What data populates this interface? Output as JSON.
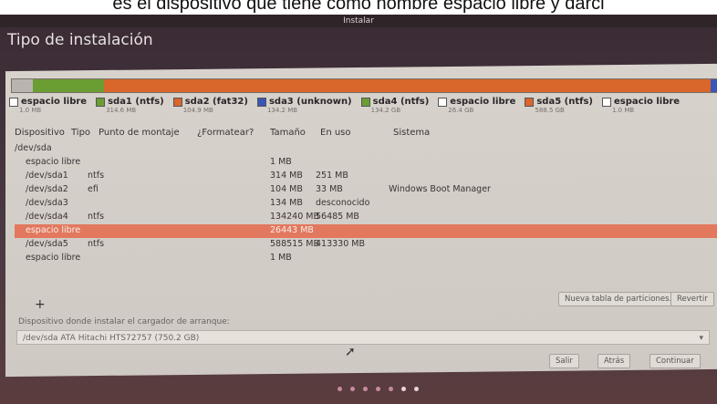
{
  "caption": "es el dispositivo que tiene como nombre espacio libre y darcl",
  "window": {
    "title": "Instalar"
  },
  "page_title": "Tipo de instalación",
  "partition_bar": [
    {
      "color": "#b9b4b0",
      "share": 3
    },
    {
      "color": "#6a9e32",
      "share": 10
    },
    {
      "color": "#d9662b",
      "share": 86
    },
    {
      "color": "#3a56b8",
      "share": 1
    }
  ],
  "legend": [
    {
      "label": "espacio libre",
      "size": "1.0 MB",
      "color": "#ffffff"
    },
    {
      "label": "sda1 (ntfs)",
      "size": "314.6 MB",
      "color": "#6a9e32"
    },
    {
      "label": "sda2 (fat32)",
      "size": "104.9 MB",
      "color": "#d9662b"
    },
    {
      "label": "sda3 (unknown)",
      "size": "134.2 MB",
      "color": "#3a56b8"
    },
    {
      "label": "sda4 (ntfs)",
      "size": "134.2 GB",
      "color": "#6a9e32"
    },
    {
      "label": "espacio libre",
      "size": "26.4 GB",
      "color": "#ffffff"
    },
    {
      "label": "sda5 (ntfs)",
      "size": "588.5 GB",
      "color": "#d9662b"
    },
    {
      "label": "espacio libre",
      "size": "1.0 MB",
      "color": "#ffffff"
    }
  ],
  "table": {
    "headers": [
      "Dispositivo",
      "Tipo",
      "Punto de montaje",
      "¿Formatear?",
      "Tamaño",
      "En uso",
      "Sistema"
    ],
    "rows": [
      {
        "device": "/dev/sda",
        "type": "",
        "size": "",
        "used": "",
        "system": ""
      },
      {
        "device": "espacio libre",
        "type": "",
        "size": "1 MB",
        "used": "",
        "system": ""
      },
      {
        "device": "/dev/sda1",
        "type": "ntfs",
        "size": "314 MB",
        "used": "251 MB",
        "system": ""
      },
      {
        "device": "/dev/sda2",
        "type": "efi",
        "size": "104 MB",
        "used": "33 MB",
        "system": "Windows Boot Manager"
      },
      {
        "device": "/dev/sda3",
        "type": "",
        "size": "134 MB",
        "used": "desconocido",
        "system": ""
      },
      {
        "device": "/dev/sda4",
        "type": "ntfs",
        "size": "134240 MB",
        "used": "56485 MB",
        "system": ""
      },
      {
        "device": "espacio libre",
        "type": "",
        "size": "26443 MB",
        "used": "",
        "system": ""
      },
      {
        "device": "/dev/sda5",
        "type": "ntfs",
        "size": "588515 MB",
        "used": "413330 MB",
        "system": ""
      },
      {
        "device": "espacio libre",
        "type": "",
        "size": "1 MB",
        "used": "",
        "system": ""
      }
    ]
  },
  "buttons": {
    "add": "+",
    "new_table": "Nueva tabla de particiones...",
    "revert": "Revertir",
    "quit": "Salir",
    "back": "Atrás",
    "continue": "Continuar"
  },
  "bootloader": {
    "label": "Dispositivo donde instalar el cargador de arranque:",
    "value": "/dev/sda  ATA Hitachi HTS72757 (750.2 GB)"
  }
}
